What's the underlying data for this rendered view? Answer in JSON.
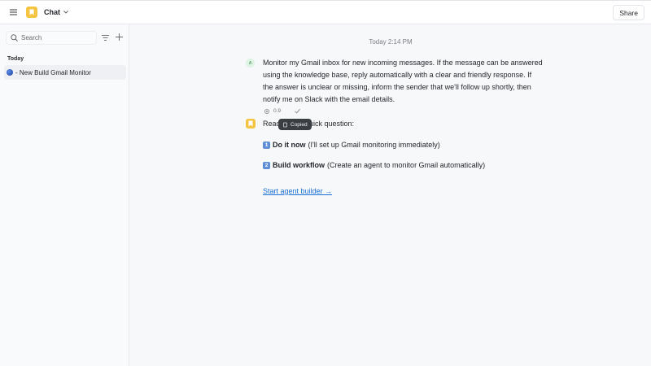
{
  "header": {
    "menu_icon": "hamburger-menu-icon",
    "app_icon": "bookmark-logo-icon",
    "title": "Chat",
    "share_label": "Share"
  },
  "sidebar": {
    "search_placeholder": "Search",
    "section_label": "Today",
    "conversations": [
      {
        "label": "- New Build Gmail Monitor"
      }
    ]
  },
  "chat": {
    "timestamp": "Today 2:14 PM",
    "user_avatar_initial": "A",
    "user_message": "Monitor my Gmail inbox for new incoming messages. If the message can be answered using the knowledge base, reply automatically with a clear and friendly response. If the answer is unclear or missing, inform the sender that we'll follow up shortly, then notify me on Slack with the email details.",
    "score": "0.9",
    "tooltip": "Copied",
    "bot_intro_start": "Reac",
    "bot_intro_end": "Quick question:",
    "options": [
      {
        "number": "1",
        "title": "Do it now",
        "desc": "(I'll set up Gmail monitoring immediately)"
      },
      {
        "number": "2",
        "title": "Build workflow",
        "desc": "(Create an agent to monitor Gmail automatically)"
      }
    ],
    "start_link": "Start agent builder →"
  },
  "colors": {
    "accent_yellow": "#f5c542",
    "link_blue": "#1a6fd6",
    "badge_blue": "#5e8fd6",
    "tooltip_bg": "#3a3d42"
  }
}
